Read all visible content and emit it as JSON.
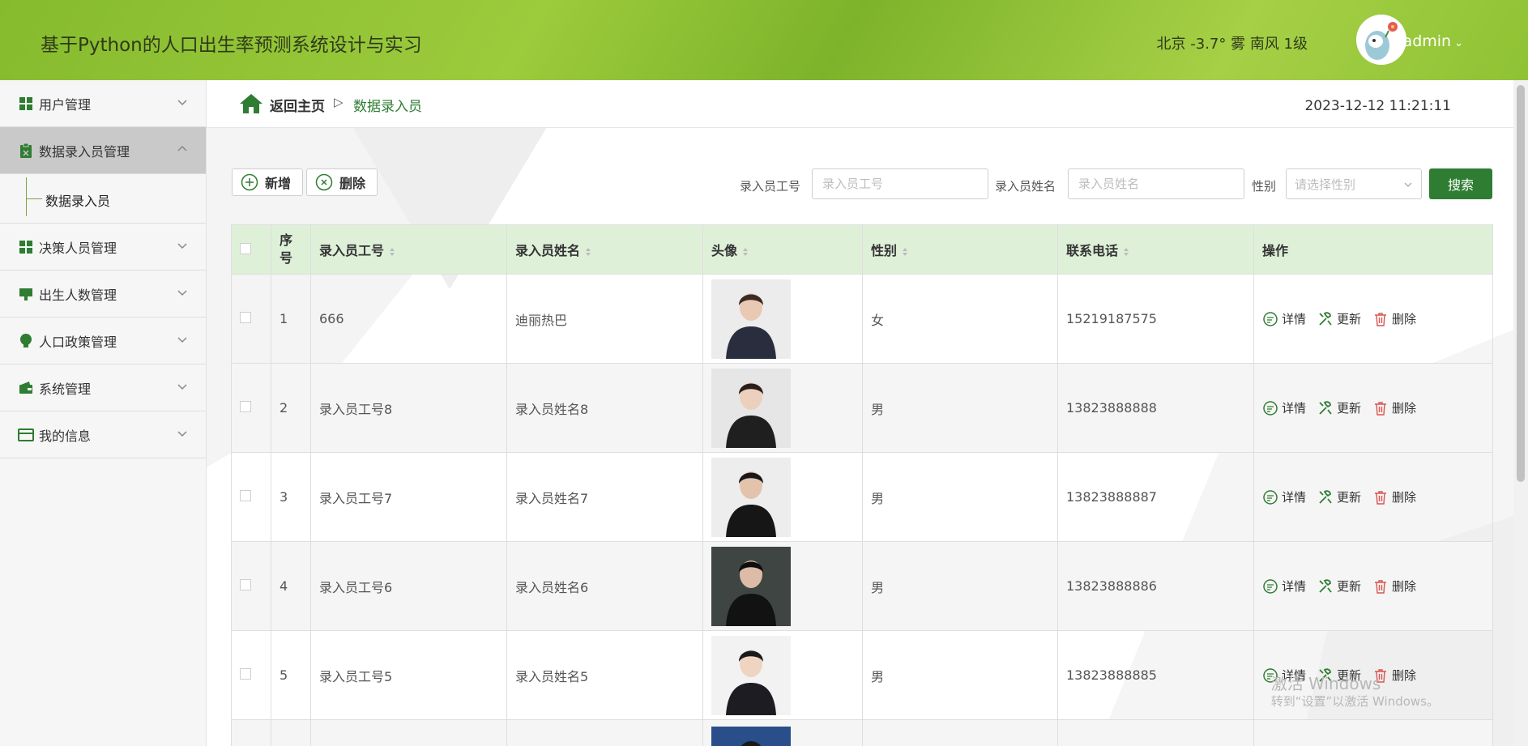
{
  "header": {
    "title": "基于Python的人口出生率预测系统设计与实习",
    "weather": "北京 -3.7° 雾 南风 1级",
    "username": "admin"
  },
  "sidebar": {
    "items": [
      {
        "label": "用户管理",
        "icon": "grid-icon"
      },
      {
        "label": "数据录入员管理",
        "icon": "clipboard-icon"
      },
      {
        "label": "决策人员管理",
        "icon": "grid-icon"
      },
      {
        "label": "出生人数管理",
        "icon": "monitor-icon"
      },
      {
        "label": "人口政策管理",
        "icon": "bulb-icon"
      },
      {
        "label": "系统管理",
        "icon": "wallet-icon"
      },
      {
        "label": "我的信息",
        "icon": "card-icon"
      }
    ],
    "submenu_label": "数据录入员"
  },
  "breadcrumb": {
    "home": "返回主页",
    "separator": "▷",
    "current": "数据录入员",
    "datetime": "2023-12-12 11:21:11"
  },
  "toolbar": {
    "add": "新增",
    "delete": "删除",
    "label_id": "录入员工号",
    "placeholder_id": "录入员工号",
    "label_name": "录入员姓名",
    "placeholder_name": "录入员姓名",
    "label_gender": "性别",
    "placeholder_gender": "请选择性别",
    "search": "搜索"
  },
  "table": {
    "headers": [
      "序号",
      "录入员工号",
      "录入员姓名",
      "头像",
      "性别",
      "联系电话",
      "操作"
    ],
    "ops": [
      "详情",
      "更新",
      "删除"
    ],
    "rows": [
      {
        "no": "1",
        "id": "666",
        "name": "迪丽热巴",
        "gender": "女",
        "phone": "15219187575"
      },
      {
        "no": "2",
        "id": "录入员工号8",
        "name": "录入员姓名8",
        "gender": "男",
        "phone": "13823888888"
      },
      {
        "no": "3",
        "id": "录入员工号7",
        "name": "录入员姓名7",
        "gender": "男",
        "phone": "13823888887"
      },
      {
        "no": "4",
        "id": "录入员工号6",
        "name": "录入员姓名6",
        "gender": "男",
        "phone": "13823888886"
      },
      {
        "no": "5",
        "id": "录入员工号5",
        "name": "录入员姓名5",
        "gender": "男",
        "phone": "13823888885"
      }
    ]
  },
  "watermark": {
    "line1": "激活 Windows",
    "line2": "转到“设置”以激活 Windows。"
  }
}
